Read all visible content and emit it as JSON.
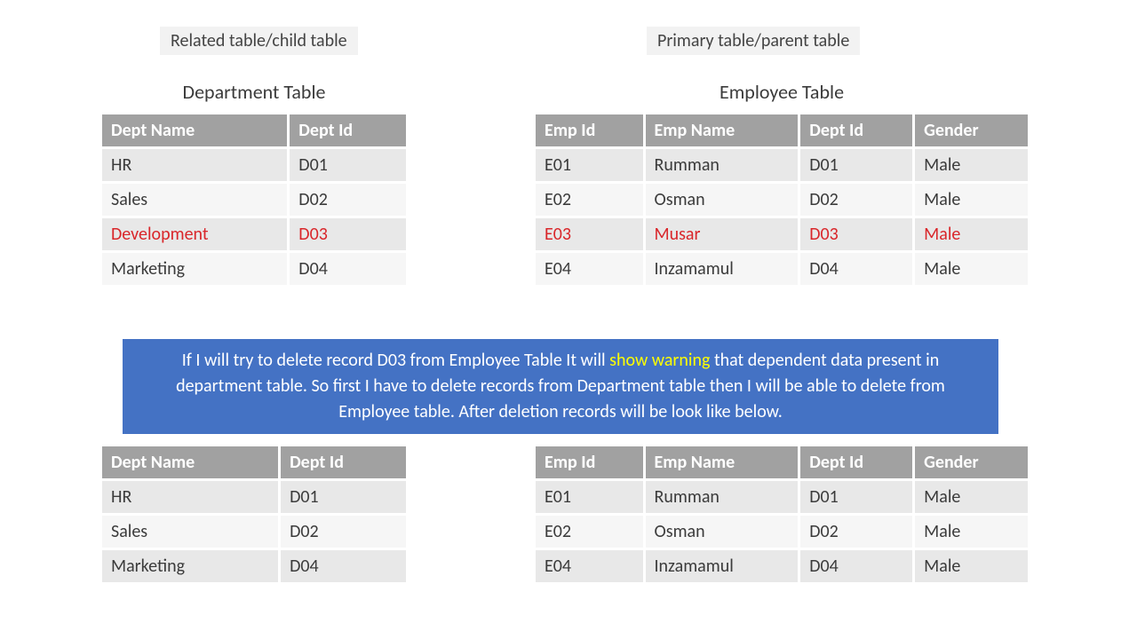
{
  "labels": {
    "left": "Related table/child table",
    "right": "Primary table/parent table"
  },
  "titles": {
    "left": "Department Table",
    "right": "Employee Table"
  },
  "dept": {
    "headers": {
      "name": "Dept Name",
      "id": "Dept Id"
    },
    "rows": [
      {
        "name": "HR",
        "id": "D01",
        "hl": false
      },
      {
        "name": "Sales",
        "id": "D02",
        "hl": false
      },
      {
        "name": "Development",
        "id": "D03",
        "hl": true
      },
      {
        "name": "Marketing",
        "id": "D04",
        "hl": false
      }
    ],
    "after_rows": [
      {
        "name": "HR",
        "id": "D01"
      },
      {
        "name": "Sales",
        "id": "D02"
      },
      {
        "name": "Marketing",
        "id": "D04"
      }
    ]
  },
  "emp": {
    "headers": {
      "id": "Emp Id",
      "name": "Emp Name",
      "dept": "Dept Id",
      "gender": "Gender"
    },
    "rows": [
      {
        "id": "E01",
        "name": "Rumman",
        "dept": "D01",
        "gender": "Male",
        "hl": false
      },
      {
        "id": "E02",
        "name": "Osman",
        "dept": "D02",
        "gender": "Male",
        "hl": false
      },
      {
        "id": "E03",
        "name": "Musar",
        "dept": "D03",
        "gender": "Male",
        "hl": true
      },
      {
        "id": "E04",
        "name": "Inzamamul",
        "dept": "D04",
        "gender": "Male",
        "hl": false
      }
    ],
    "after_rows": [
      {
        "id": "E01",
        "name": "Rumman",
        "dept": "D01",
        "gender": "Male"
      },
      {
        "id": "E02",
        "name": "Osman",
        "dept": "D02",
        "gender": "Male"
      },
      {
        "id": "E04",
        "name": "Inzamamul",
        "dept": "D04",
        "gender": "Male"
      }
    ]
  },
  "callout": {
    "pre": "If I will try to delete record D03 from Employee Table It will ",
    "warn": "show warning",
    "post": " that dependent data present in department table. So first I have to delete records from Department table then I will be able to delete from Employee table. After deletion records will be look like below."
  }
}
